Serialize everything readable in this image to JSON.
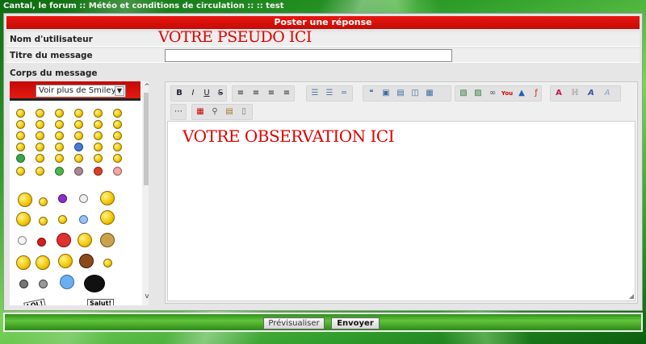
{
  "breadcrumb": "Cantal, le forum :: Météo et conditions de circulation :: :: test",
  "panel": {
    "title": "Poster une réponse",
    "username_label": "Nom d'utilisateur",
    "username_value": "VOTRE PSEUDO ICI",
    "subject_label": "Titre du message",
    "subject_value": "",
    "body_label": "Corps du message"
  },
  "smileys": {
    "select_value": "Voir plus de Smileys",
    "speech_signs": [
      "LOL!",
      "Salut!"
    ]
  },
  "editor": {
    "body_text": "VOTRE OBSERVATION ICI",
    "toolbar_row1": [
      "B",
      "I",
      "U",
      "S",
      "align-left",
      "align-center",
      "align-right",
      "justify",
      "bulleted-list",
      "numbered-list",
      "horizontal-rule",
      "quote",
      "spoiler",
      "code",
      "hide",
      "table",
      "image",
      "image-host",
      "link",
      "youtube",
      "dailymotion",
      "flash",
      "color",
      "font-size",
      "font",
      "clear-format"
    ],
    "toolbar_row2": [
      "more",
      "date",
      "search",
      "paste",
      "new-page"
    ]
  },
  "buttons": {
    "preview": "Prévisualiser",
    "submit": "Envoyer"
  },
  "colors": {
    "header_red": "#d8100a",
    "placeholder_red": "#e00000",
    "footer_green": "#4db02e"
  }
}
